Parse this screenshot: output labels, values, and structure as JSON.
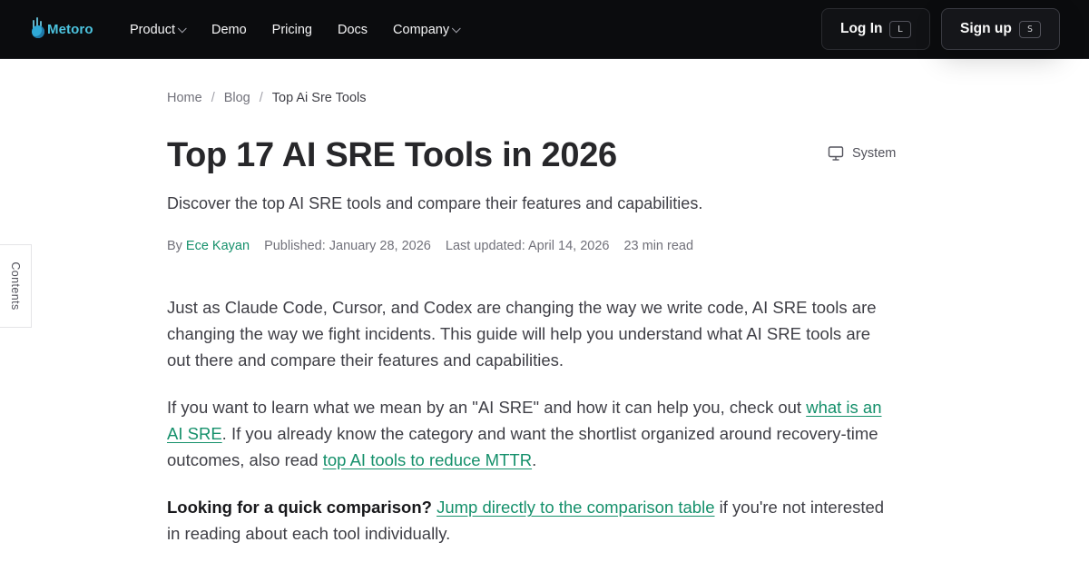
{
  "header": {
    "logo_text": "Metoro",
    "nav": [
      {
        "label": "Product",
        "dropdown": true
      },
      {
        "label": "Demo",
        "dropdown": false
      },
      {
        "label": "Pricing",
        "dropdown": false
      },
      {
        "label": "Docs",
        "dropdown": false
      },
      {
        "label": "Company",
        "dropdown": true
      }
    ],
    "login": {
      "label": "Log In",
      "shortcut": "L"
    },
    "signup": {
      "label": "Sign up",
      "shortcut": "S"
    }
  },
  "sidebar": {
    "contents_label": "Contents"
  },
  "breadcrumb": {
    "home": "Home",
    "sep": "/",
    "blog": "Blog",
    "current": "Top Ai Sre Tools"
  },
  "article": {
    "title": "Top 17 AI SRE Tools in 2026",
    "theme_toggle": "System",
    "subtitle": "Discover the top AI SRE tools and compare their features and capabilities.",
    "meta": {
      "by": "By",
      "author": "Ece Kayan",
      "published": "Published: January 28, 2026",
      "updated": "Last updated: April 14, 2026",
      "read_time": "23 min read"
    },
    "p1": "Just as Claude Code, Cursor, and Codex are changing the way we write code, AI SRE tools are changing the way we fight incidents. This guide will help you understand what AI SRE tools are out there and compare their features and capabilities.",
    "p2": {
      "pre": "If you want to learn what we mean by an \"AI SRE\" and how it can help you, check out ",
      "link1": "what is an AI SRE",
      "mid": ". If you already know the category and want the shortlist organized around recovery-time outcomes, also read ",
      "link2": "top AI tools to reduce MTTR",
      "post": "."
    },
    "p3": {
      "bold": "Looking for a quick comparison?",
      "link": "Jump directly to the comparison table",
      "post": " if you're not interested in reading about each tool individually."
    }
  },
  "colors": {
    "header_bg": "#0b0c0e",
    "brand": "#4cc3de",
    "link": "#15906b"
  }
}
